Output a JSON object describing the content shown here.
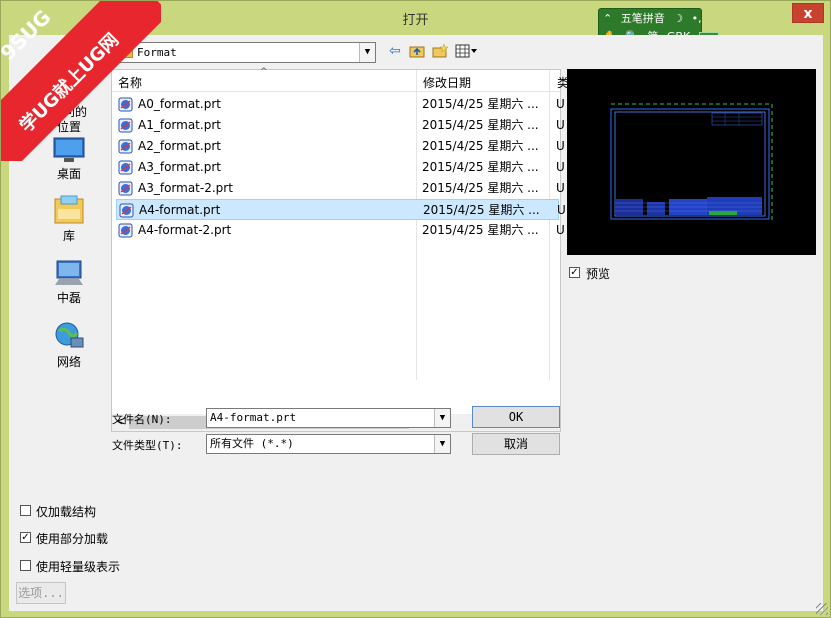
{
  "window": {
    "title": "打开",
    "close_label": "x"
  },
  "ime": {
    "row1": [
      "⌃",
      "五笔拼音",
      "☽",
      "•,"
    ],
    "row2": [
      "✋",
      "🔍",
      "简",
      "GBK"
    ]
  },
  "watermark": {
    "line1": "9SUG",
    "line2": "学UG就上UG网"
  },
  "places": [
    {
      "label": "访问的位置",
      "icon": "recent-places-icon"
    },
    {
      "label": "桌面",
      "icon": "desktop-icon"
    },
    {
      "label": "库",
      "icon": "library-icon"
    },
    {
      "label": "中磊",
      "icon": "computer-icon"
    },
    {
      "label": "网络",
      "icon": "network-icon"
    }
  ],
  "lookin": {
    "value": "Format",
    "arrow": "▼"
  },
  "toolbar_icons": [
    "back-arrow-icon",
    "up-folder-icon",
    "new-folder-icon",
    "view-menu-icon"
  ],
  "filelist": {
    "columns": {
      "name": "名称",
      "date": "修改日期",
      "extra": "类"
    },
    "files": [
      {
        "name": "A0_format.prt",
        "date": "2015/4/25 星期六 ...",
        "extra": "U",
        "selected": false
      },
      {
        "name": "A1_format.prt",
        "date": "2015/4/25 星期六 ...",
        "extra": "U",
        "selected": false
      },
      {
        "name": "A2_format.prt",
        "date": "2015/4/25 星期六 ...",
        "extra": "U",
        "selected": false
      },
      {
        "name": "A3_format.prt",
        "date": "2015/4/25 星期六 ...",
        "extra": "U",
        "selected": false
      },
      {
        "name": "A3_format-2.prt",
        "date": "2015/4/25 星期六 ...",
        "extra": "U",
        "selected": false
      },
      {
        "name": "A4-format.prt",
        "date": "2015/4/25 星期六 ...",
        "extra": "U",
        "selected": true
      },
      {
        "name": "A4-format-2.prt",
        "date": "2015/4/25 星期六 ...",
        "extra": "U",
        "selected": false
      }
    ],
    "scroll_left": "<",
    "scroll_right": ">"
  },
  "preview": {
    "label": "预览",
    "checked": true
  },
  "form": {
    "filename_label": "文件名(N):",
    "filename_value": "A4-format.prt",
    "filetype_label": "文件类型(T):",
    "filetype_value": "所有文件 (*.*)",
    "ok_label": "OK",
    "cancel_label": "取消"
  },
  "options": [
    {
      "label": "仅加载结构",
      "checked": false
    },
    {
      "label": "使用部分加载",
      "checked": true
    },
    {
      "label": "使用轻量级表示",
      "checked": false
    }
  ],
  "options_button": "选项..."
}
